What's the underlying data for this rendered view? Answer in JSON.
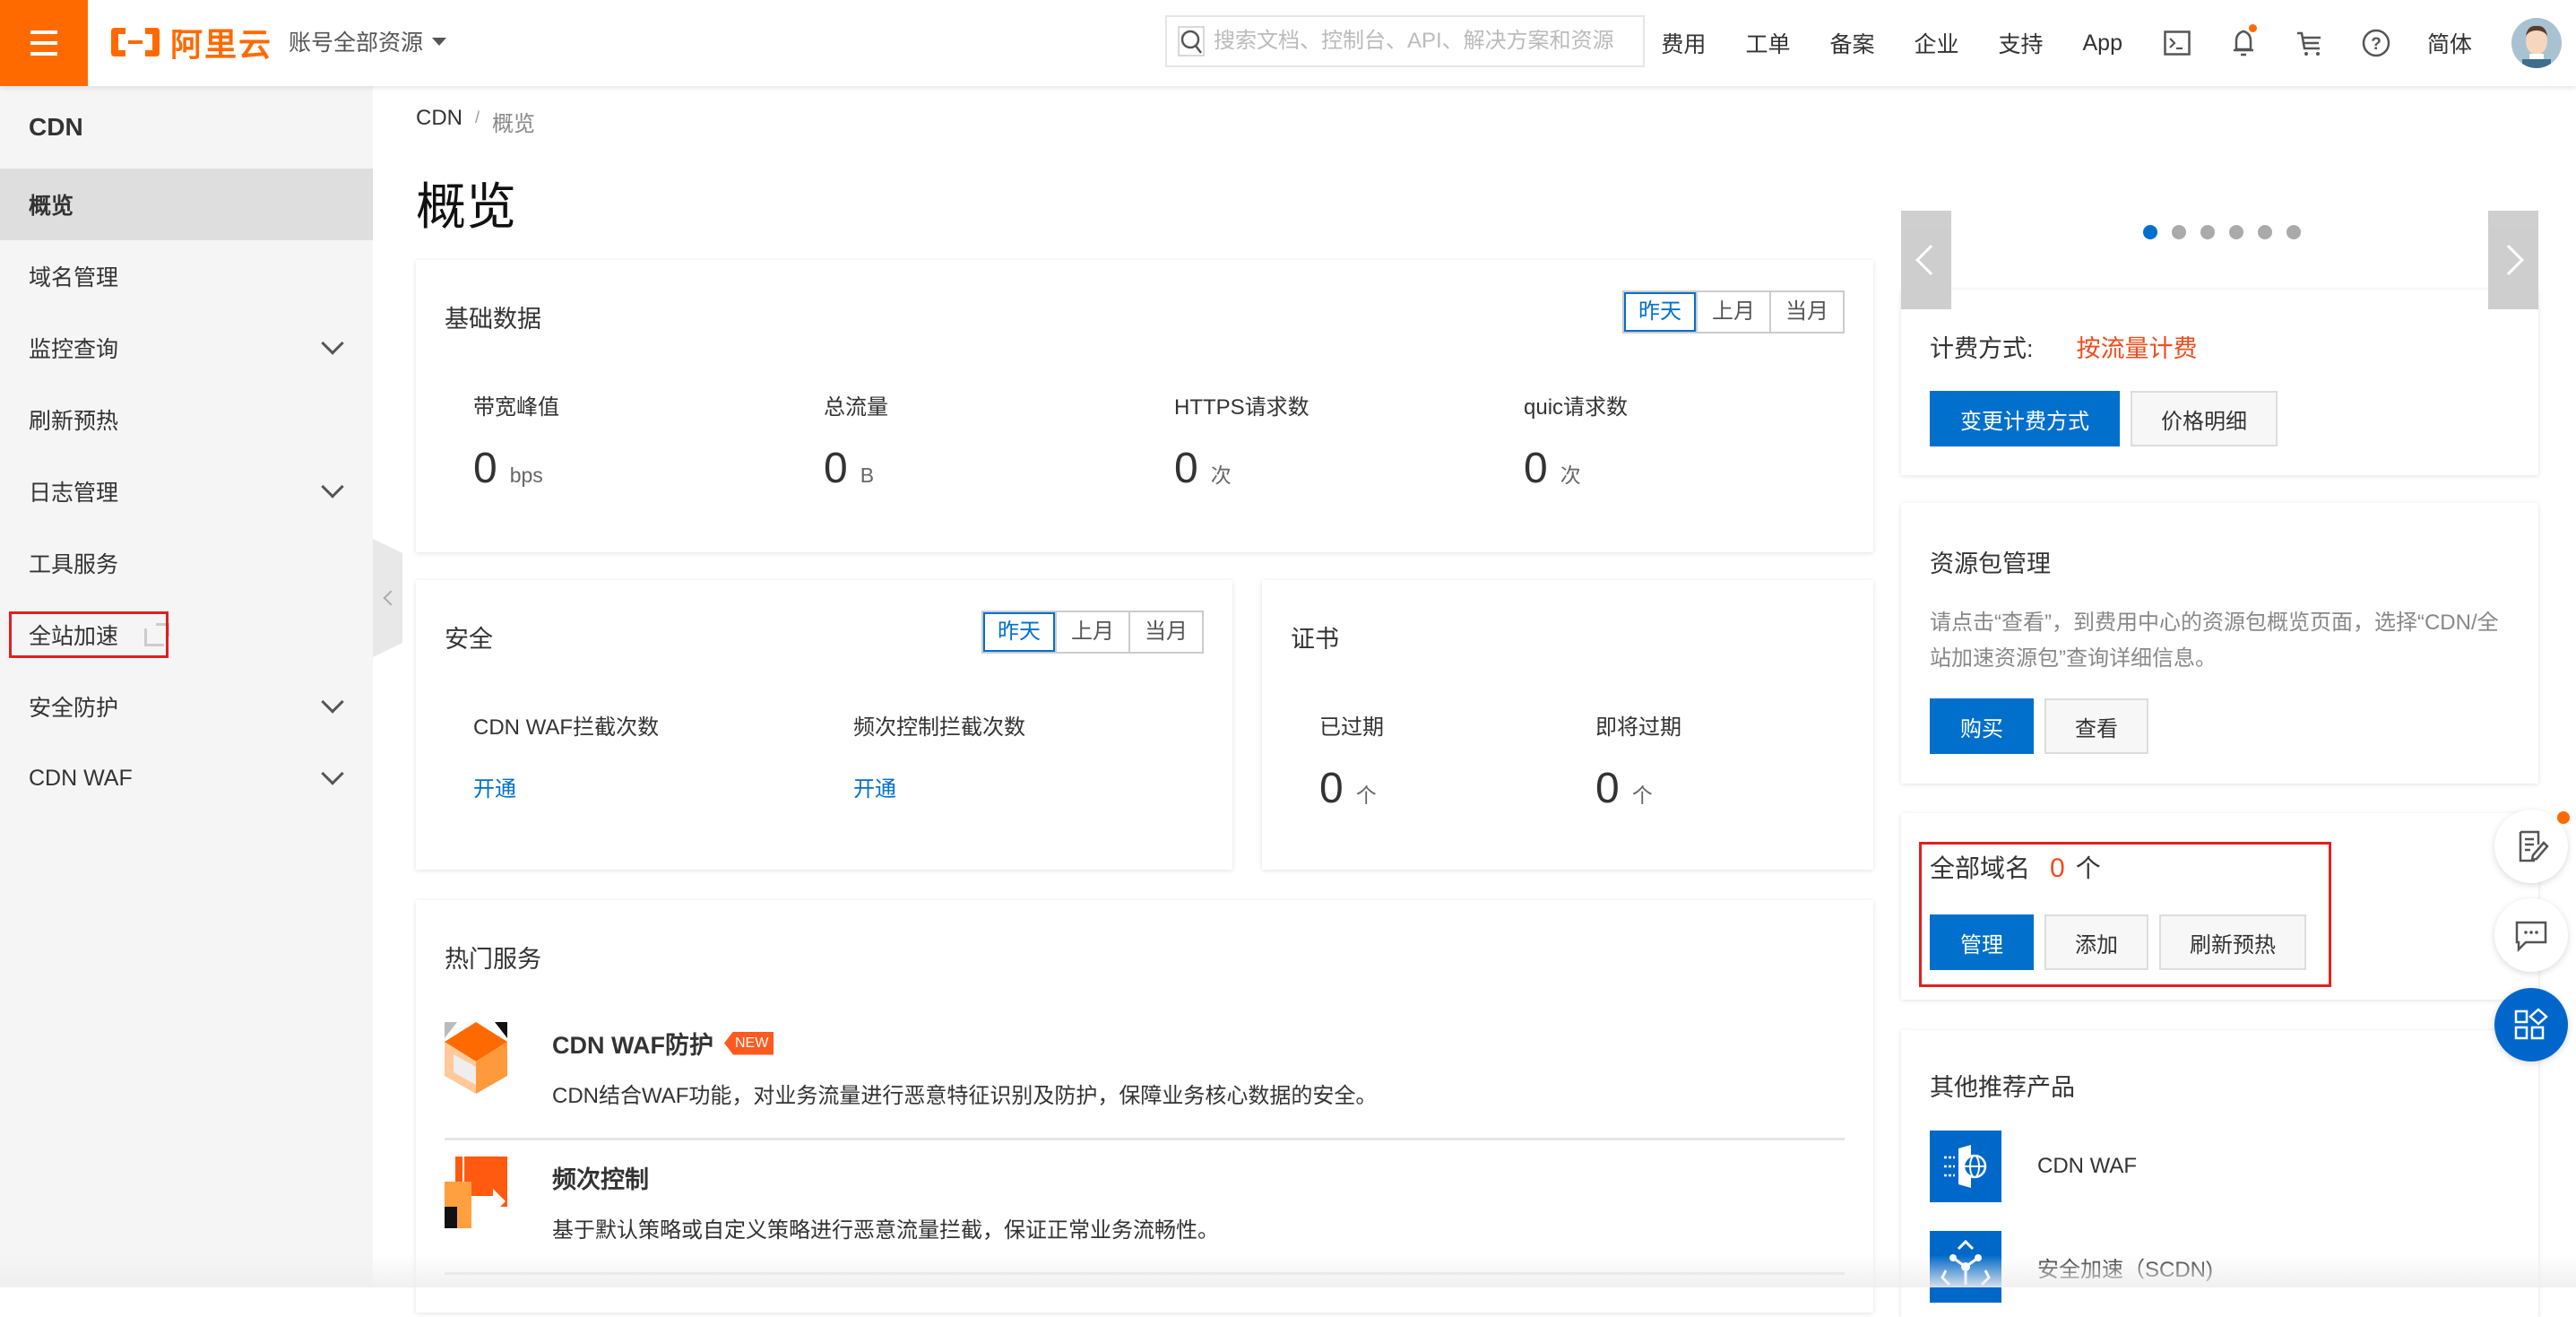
{
  "topbar": {
    "logo_text": "阿里云",
    "account_selector": "账号全部资源",
    "search_placeholder": "搜索文档、控制台、API、解决方案和资源",
    "nav_links": [
      "费用",
      "工单",
      "备案",
      "企业",
      "支持",
      "App"
    ],
    "icons": [
      "terminal-icon",
      "bell-icon",
      "cart-icon",
      "help-icon"
    ],
    "language": "简体"
  },
  "sidebar": {
    "title": "CDN",
    "items": [
      {
        "label": "概览",
        "active": true,
        "expandable": false
      },
      {
        "label": "域名管理",
        "active": false,
        "expandable": false
      },
      {
        "label": "监控查询",
        "active": false,
        "expandable": true
      },
      {
        "label": "刷新预热",
        "active": false,
        "expandable": false
      },
      {
        "label": "日志管理",
        "active": false,
        "expandable": true
      },
      {
        "label": "工具服务",
        "active": false,
        "expandable": false
      },
      {
        "label": "全站加速",
        "active": false,
        "expandable": false,
        "external": true,
        "highlighted": true
      },
      {
        "label": "安全防护",
        "active": false,
        "expandable": true
      },
      {
        "label": "CDN WAF",
        "active": false,
        "expandable": true
      }
    ]
  },
  "breadcrumb": [
    "CDN",
    "概览"
  ],
  "page_title": "概览",
  "basic_data": {
    "title": "基础数据",
    "periods": [
      "昨天",
      "上月",
      "当月"
    ],
    "selected_period": "昨天",
    "metrics": [
      {
        "label": "带宽峰值",
        "value": "0",
        "unit": "bps"
      },
      {
        "label": "总流量",
        "value": "0",
        "unit": "B"
      },
      {
        "label": "HTTPS请求数",
        "value": "0",
        "unit": "次"
      },
      {
        "label": "quic请求数",
        "value": "0",
        "unit": "次"
      }
    ]
  },
  "security": {
    "title": "安全",
    "periods": [
      "昨天",
      "上月",
      "当月"
    ],
    "selected_period": "昨天",
    "metrics": [
      {
        "label": "CDN WAF拦截次数",
        "link": "开通"
      },
      {
        "label": "频次控制拦截次数",
        "link": "开通"
      }
    ]
  },
  "certificate": {
    "title": "证书",
    "metrics": [
      {
        "label": "已过期",
        "value": "0",
        "unit": "个"
      },
      {
        "label": "即将过期",
        "value": "0",
        "unit": "个"
      }
    ]
  },
  "hot_services": {
    "title": "热门服务",
    "items": [
      {
        "name": "CDN WAF防护",
        "badge": "NEW",
        "desc": "CDN结合WAF功能，对业务流量进行恶意特征识别及防护，保障业务核心数据的安全。"
      },
      {
        "name": "频次控制",
        "badge": "",
        "desc": "基于默认策略或自定义策略进行恶意流量拦截，保证正常业务流畅性。"
      }
    ]
  },
  "carousel": {
    "slide_count": 6,
    "active_index": 0
  },
  "billing": {
    "label": "计费方式:",
    "value": "按流量计费",
    "primary_button": "变更计费方式",
    "secondary_button": "价格明细"
  },
  "resource_package": {
    "title": "资源包管理",
    "desc": "请点击“查看”，到费用中心的资源包概览页面，选择“CDN/全站加速资源包”查询详细信息。",
    "primary_button": "购买",
    "secondary_button": "查看"
  },
  "domains": {
    "label": "全部域名",
    "count": "0",
    "unit": "个",
    "buttons": [
      "管理",
      "添加",
      "刷新预热"
    ]
  },
  "recommended": {
    "title": "其他推荐产品",
    "items": [
      "CDN WAF",
      "安全加速（SCDN)"
    ]
  },
  "colors": {
    "brand_orange": "#ff6a00",
    "primary_blue": "#0070cc",
    "highlight_red": "#e02020",
    "value_orange": "#f04b1b"
  }
}
